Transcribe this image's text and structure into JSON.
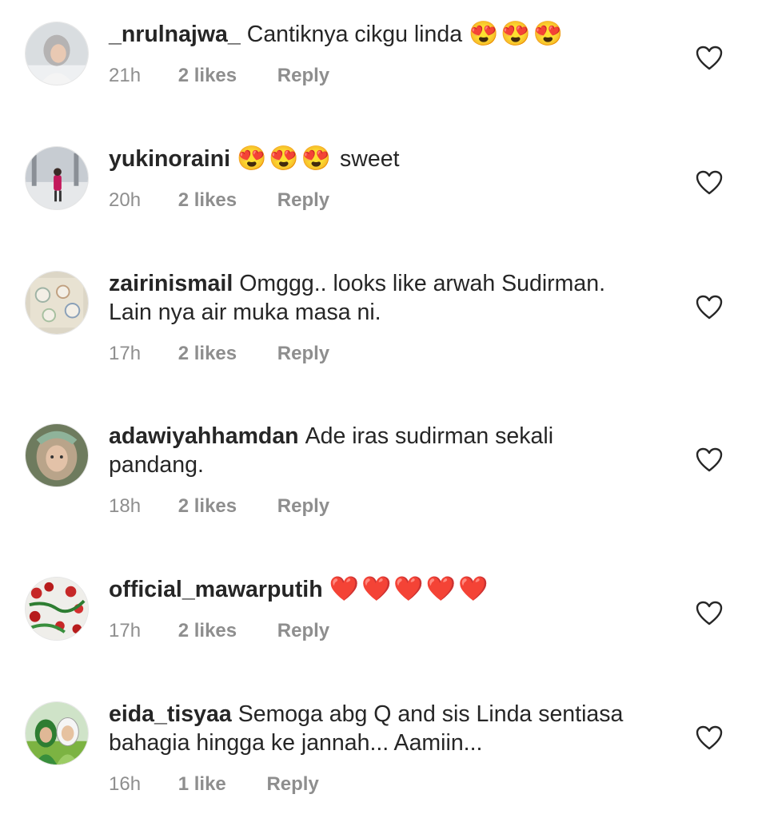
{
  "comments": [
    {
      "username": "_nrulnajwa_",
      "text": "Cantiknya cikgu linda",
      "emoji": "😍😍😍",
      "text_after": "",
      "time": "21h",
      "likes": "2 likes",
      "reply": "Reply"
    },
    {
      "username": "yukinoraini",
      "text": "",
      "emoji": "😍😍😍",
      "text_after": "sweet",
      "time": "20h",
      "likes": "2 likes",
      "reply": "Reply"
    },
    {
      "username": "zairinismail",
      "text": "Omggg.. looks like arwah Sudirman. Lain nya air muka masa ni.",
      "emoji": "",
      "text_after": "",
      "time": "17h",
      "likes": "2 likes",
      "reply": "Reply"
    },
    {
      "username": "adawiyahhamdan",
      "text": "Ade iras sudirman sekali pandang.",
      "emoji": "",
      "text_after": "",
      "time": "18h",
      "likes": "2 likes",
      "reply": "Reply"
    },
    {
      "username": "official_mawarputih",
      "text": "",
      "emoji": "❤️❤️❤️❤️❤️",
      "text_after": "",
      "time": "17h",
      "likes": "2 likes",
      "reply": "Reply"
    },
    {
      "username": "eida_tisyaa",
      "text": "Semoga abg Q and sis Linda sentiasa bahagia hingga ke jannah... Aamiin...",
      "emoji": "",
      "text_after": "",
      "time": "16h",
      "likes": "1 like",
      "reply": "Reply"
    }
  ],
  "icons": {
    "avatar": "user-avatar",
    "like": "heart-outline-icon"
  },
  "colors": {
    "text": "#262626",
    "meta": "#8e8e8e"
  }
}
